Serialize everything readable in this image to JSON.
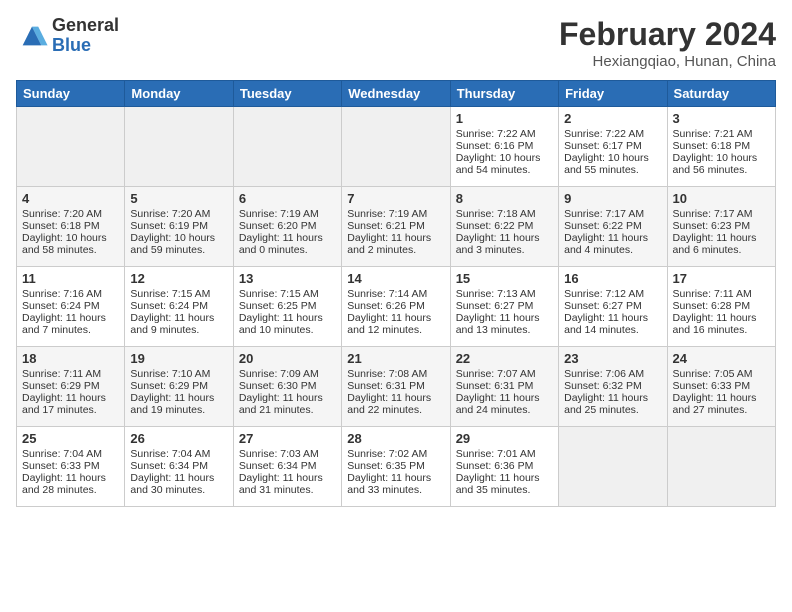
{
  "header": {
    "logo_general": "General",
    "logo_blue": "Blue",
    "title": "February 2024",
    "location": "Hexiangqiao, Hunan, China"
  },
  "days_of_week": [
    "Sunday",
    "Monday",
    "Tuesday",
    "Wednesday",
    "Thursday",
    "Friday",
    "Saturday"
  ],
  "weeks": [
    [
      {
        "day": "",
        "empty": true
      },
      {
        "day": "",
        "empty": true
      },
      {
        "day": "",
        "empty": true
      },
      {
        "day": "",
        "empty": true
      },
      {
        "day": "1",
        "sunrise": "7:22 AM",
        "sunset": "6:16 PM",
        "daylight": "10 hours and 54 minutes."
      },
      {
        "day": "2",
        "sunrise": "7:22 AM",
        "sunset": "6:17 PM",
        "daylight": "10 hours and 55 minutes."
      },
      {
        "day": "3",
        "sunrise": "7:21 AM",
        "sunset": "6:18 PM",
        "daylight": "10 hours and 56 minutes."
      }
    ],
    [
      {
        "day": "4",
        "sunrise": "7:20 AM",
        "sunset": "6:18 PM",
        "daylight": "10 hours and 58 minutes."
      },
      {
        "day": "5",
        "sunrise": "7:20 AM",
        "sunset": "6:19 PM",
        "daylight": "10 hours and 59 minutes."
      },
      {
        "day": "6",
        "sunrise": "7:19 AM",
        "sunset": "6:20 PM",
        "daylight": "11 hours and 0 minutes."
      },
      {
        "day": "7",
        "sunrise": "7:19 AM",
        "sunset": "6:21 PM",
        "daylight": "11 hours and 2 minutes."
      },
      {
        "day": "8",
        "sunrise": "7:18 AM",
        "sunset": "6:22 PM",
        "daylight": "11 hours and 3 minutes."
      },
      {
        "day": "9",
        "sunrise": "7:17 AM",
        "sunset": "6:22 PM",
        "daylight": "11 hours and 4 minutes."
      },
      {
        "day": "10",
        "sunrise": "7:17 AM",
        "sunset": "6:23 PM",
        "daylight": "11 hours and 6 minutes."
      }
    ],
    [
      {
        "day": "11",
        "sunrise": "7:16 AM",
        "sunset": "6:24 PM",
        "daylight": "11 hours and 7 minutes."
      },
      {
        "day": "12",
        "sunrise": "7:15 AM",
        "sunset": "6:24 PM",
        "daylight": "11 hours and 9 minutes."
      },
      {
        "day": "13",
        "sunrise": "7:15 AM",
        "sunset": "6:25 PM",
        "daylight": "11 hours and 10 minutes."
      },
      {
        "day": "14",
        "sunrise": "7:14 AM",
        "sunset": "6:26 PM",
        "daylight": "11 hours and 12 minutes."
      },
      {
        "day": "15",
        "sunrise": "7:13 AM",
        "sunset": "6:27 PM",
        "daylight": "11 hours and 13 minutes."
      },
      {
        "day": "16",
        "sunrise": "7:12 AM",
        "sunset": "6:27 PM",
        "daylight": "11 hours and 14 minutes."
      },
      {
        "day": "17",
        "sunrise": "7:11 AM",
        "sunset": "6:28 PM",
        "daylight": "11 hours and 16 minutes."
      }
    ],
    [
      {
        "day": "18",
        "sunrise": "7:11 AM",
        "sunset": "6:29 PM",
        "daylight": "11 hours and 17 minutes."
      },
      {
        "day": "19",
        "sunrise": "7:10 AM",
        "sunset": "6:29 PM",
        "daylight": "11 hours and 19 minutes."
      },
      {
        "day": "20",
        "sunrise": "7:09 AM",
        "sunset": "6:30 PM",
        "daylight": "11 hours and 21 minutes."
      },
      {
        "day": "21",
        "sunrise": "7:08 AM",
        "sunset": "6:31 PM",
        "daylight": "11 hours and 22 minutes."
      },
      {
        "day": "22",
        "sunrise": "7:07 AM",
        "sunset": "6:31 PM",
        "daylight": "11 hours and 24 minutes."
      },
      {
        "day": "23",
        "sunrise": "7:06 AM",
        "sunset": "6:32 PM",
        "daylight": "11 hours and 25 minutes."
      },
      {
        "day": "24",
        "sunrise": "7:05 AM",
        "sunset": "6:33 PM",
        "daylight": "11 hours and 27 minutes."
      }
    ],
    [
      {
        "day": "25",
        "sunrise": "7:04 AM",
        "sunset": "6:33 PM",
        "daylight": "11 hours and 28 minutes."
      },
      {
        "day": "26",
        "sunrise": "7:04 AM",
        "sunset": "6:34 PM",
        "daylight": "11 hours and 30 minutes."
      },
      {
        "day": "27",
        "sunrise": "7:03 AM",
        "sunset": "6:34 PM",
        "daylight": "11 hours and 31 minutes."
      },
      {
        "day": "28",
        "sunrise": "7:02 AM",
        "sunset": "6:35 PM",
        "daylight": "11 hours and 33 minutes."
      },
      {
        "day": "29",
        "sunrise": "7:01 AM",
        "sunset": "6:36 PM",
        "daylight": "11 hours and 35 minutes."
      },
      {
        "day": "",
        "empty": true
      },
      {
        "day": "",
        "empty": true
      }
    ]
  ]
}
